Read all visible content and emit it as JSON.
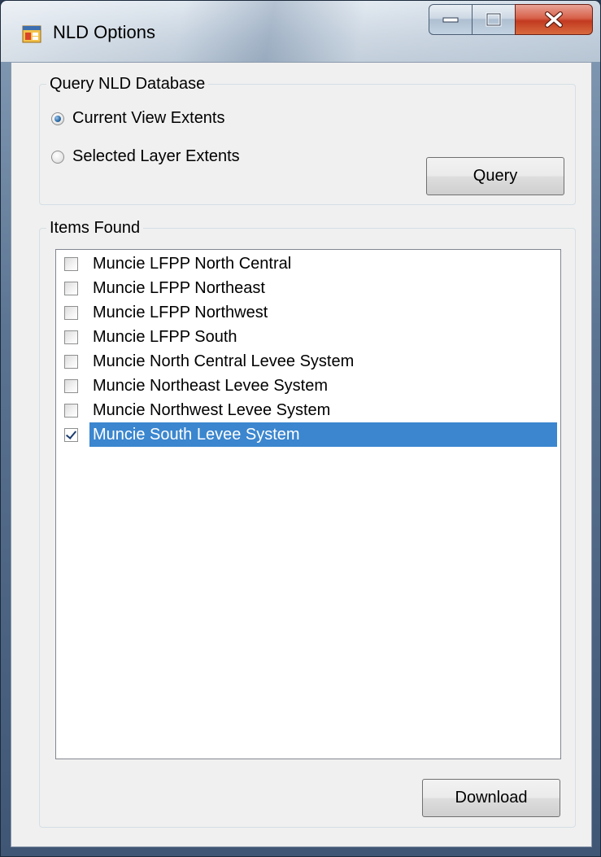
{
  "window": {
    "title": "NLD Options"
  },
  "query_group": {
    "label": "Query NLD Database",
    "options": [
      {
        "label": "Current View Extents",
        "checked": true
      },
      {
        "label": "Selected Layer Extents",
        "checked": false
      }
    ],
    "query_button": "Query"
  },
  "items_group": {
    "label": "Items Found",
    "items": [
      {
        "label": "Muncie LFPP North Central",
        "checked": false,
        "selected": false
      },
      {
        "label": "Muncie LFPP Northeast",
        "checked": false,
        "selected": false
      },
      {
        "label": "Muncie LFPP Northwest",
        "checked": false,
        "selected": false
      },
      {
        "label": "Muncie LFPP South",
        "checked": false,
        "selected": false
      },
      {
        "label": "Muncie North Central Levee System",
        "checked": false,
        "selected": false
      },
      {
        "label": "Muncie Northeast Levee System",
        "checked": false,
        "selected": false
      },
      {
        "label": "Muncie Northwest Levee System",
        "checked": false,
        "selected": false
      },
      {
        "label": "Muncie South Levee System",
        "checked": true,
        "selected": true
      }
    ]
  },
  "download_button": "Download",
  "colors": {
    "selection": "#3b86cf",
    "close_button": "#c23a20"
  }
}
